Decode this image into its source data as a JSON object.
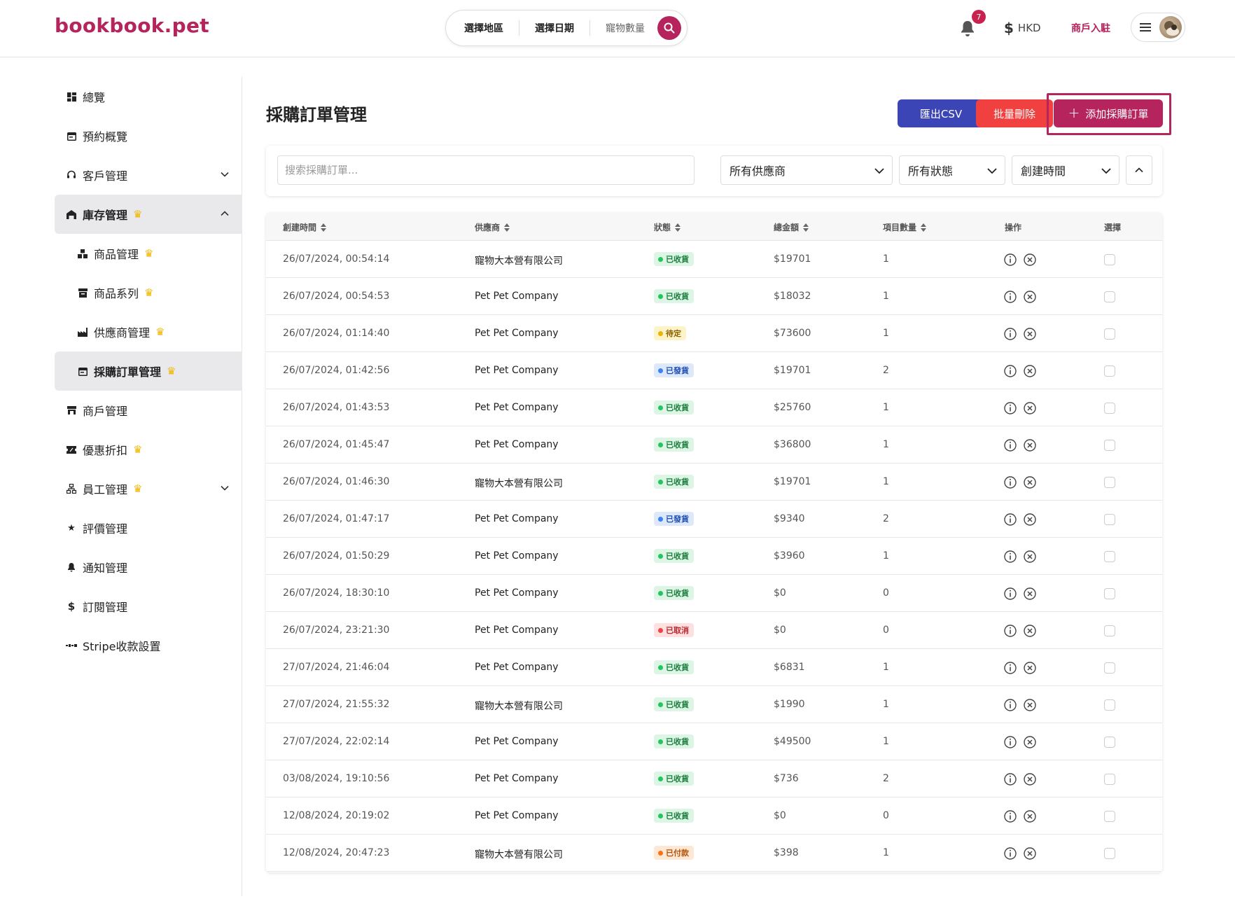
{
  "header": {
    "logo": "bookbook.pet",
    "search": {
      "region": "選擇地區",
      "date": "選擇日期",
      "pets": "寵物數量"
    },
    "notifications_count": "7",
    "currency": "HKD",
    "merchant_link": "商戶入駐"
  },
  "sidebar": {
    "items": [
      {
        "label": "總覽",
        "icon": "dashboard-icon"
      },
      {
        "label": "預約概覽",
        "icon": "calendar-icon"
      },
      {
        "label": "客戶管理",
        "icon": "headset-icon",
        "expandable": true
      },
      {
        "label": "庫存管理",
        "icon": "store-icon",
        "premium": true,
        "expanded": true
      },
      {
        "label": "商品管理",
        "icon": "boxes-icon",
        "premium": true,
        "sub": true
      },
      {
        "label": "商品系列",
        "icon": "archive-icon",
        "premium": true,
        "sub": true
      },
      {
        "label": "供應商管理",
        "icon": "factory-icon",
        "premium": true,
        "sub": true
      },
      {
        "label": "採購訂單管理",
        "icon": "calendar-icon",
        "premium": true,
        "sub": true,
        "active": true
      },
      {
        "label": "商戶管理",
        "icon": "shop-icon"
      },
      {
        "label": "優惠折扣",
        "icon": "ticket-icon",
        "premium": true
      },
      {
        "label": "員工管理",
        "icon": "org-icon",
        "premium": true,
        "expandable": true
      },
      {
        "label": "評價管理",
        "icon": "star-icon"
      },
      {
        "label": "通知管理",
        "icon": "bell-icon"
      },
      {
        "label": "訂閱管理",
        "icon": "dollar-icon"
      },
      {
        "label": "Stripe收款設置",
        "icon": "stripe-icon"
      }
    ]
  },
  "main": {
    "title": "採購訂單管理",
    "buttons": {
      "export": "匯出CSV",
      "bulk_delete": "批量刪除",
      "add": "添加採購訂單"
    },
    "filters": {
      "search_placeholder": "搜索採購訂單...",
      "supplier": "所有供應商",
      "status": "所有狀態",
      "sort": "創建時間"
    },
    "table": {
      "columns": [
        "創建時間",
        "供應商",
        "狀態",
        "總金額",
        "項目數量",
        "操作",
        "選擇"
      ],
      "rows": [
        {
          "created": "26/07/2024, 00:54:14",
          "supplier": "寵物大本營有限公司",
          "status": "已收貨",
          "status_type": "received",
          "total": "$19701",
          "qty": "1"
        },
        {
          "created": "26/07/2024, 00:54:53",
          "supplier": "Pet Pet Company",
          "status": "已收貨",
          "status_type": "received",
          "total": "$18032",
          "qty": "1"
        },
        {
          "created": "26/07/2024, 01:14:40",
          "supplier": "Pet Pet Company",
          "status": "待定",
          "status_type": "pending",
          "total": "$73600",
          "qty": "1"
        },
        {
          "created": "26/07/2024, 01:42:56",
          "supplier": "Pet Pet Company",
          "status": "已發貨",
          "status_type": "shipped",
          "total": "$19701",
          "qty": "2"
        },
        {
          "created": "26/07/2024, 01:43:53",
          "supplier": "Pet Pet Company",
          "status": "已收貨",
          "status_type": "received",
          "total": "$25760",
          "qty": "1"
        },
        {
          "created": "26/07/2024, 01:45:47",
          "supplier": "Pet Pet Company",
          "status": "已收貨",
          "status_type": "received",
          "total": "$36800",
          "qty": "1"
        },
        {
          "created": "26/07/2024, 01:46:30",
          "supplier": "寵物大本營有限公司",
          "status": "已收貨",
          "status_type": "received",
          "total": "$19701",
          "qty": "1"
        },
        {
          "created": "26/07/2024, 01:47:17",
          "supplier": "Pet Pet Company",
          "status": "已發貨",
          "status_type": "shipped",
          "total": "$9340",
          "qty": "2"
        },
        {
          "created": "26/07/2024, 01:50:29",
          "supplier": "Pet Pet Company",
          "status": "已收貨",
          "status_type": "received",
          "total": "$3960",
          "qty": "1"
        },
        {
          "created": "26/07/2024, 18:30:10",
          "supplier": "Pet Pet Company",
          "status": "已收貨",
          "status_type": "received",
          "total": "$0",
          "qty": "0"
        },
        {
          "created": "26/07/2024, 23:21:30",
          "supplier": "Pet Pet Company",
          "status": "已取消",
          "status_type": "cancelled",
          "total": "$0",
          "qty": "0"
        },
        {
          "created": "27/07/2024, 21:46:04",
          "supplier": "Pet Pet Company",
          "status": "已收貨",
          "status_type": "received",
          "total": "$6831",
          "qty": "1"
        },
        {
          "created": "27/07/2024, 21:55:32",
          "supplier": "寵物大本營有限公司",
          "status": "已收貨",
          "status_type": "received",
          "total": "$1990",
          "qty": "1"
        },
        {
          "created": "27/07/2024, 22:02:14",
          "supplier": "Pet Pet Company",
          "status": "已收貨",
          "status_type": "received",
          "total": "$49500",
          "qty": "1"
        },
        {
          "created": "03/08/2024, 19:10:56",
          "supplier": "Pet Pet Company",
          "status": "已收貨",
          "status_type": "received",
          "total": "$736",
          "qty": "2"
        },
        {
          "created": "12/08/2024, 20:19:02",
          "supplier": "Pet Pet Company",
          "status": "已收貨",
          "status_type": "received",
          "total": "$0",
          "qty": "0"
        },
        {
          "created": "12/08/2024, 20:47:23",
          "supplier": "寵物大本營有限公司",
          "status": "已付款",
          "status_type": "paid",
          "total": "$398",
          "qty": "1"
        }
      ]
    }
  },
  "colors": {
    "brand": "#b5245c",
    "export": "#3b45b5",
    "delete": "#f0403f",
    "premium": "#f2b600",
    "status_received_bg": "#dcf5e4",
    "status_received_fg": "#1a7f3e",
    "status_received_dot": "#22c55e",
    "status_pending_bg": "#fdf3c8",
    "status_pending_fg": "#8a6100",
    "status_pending_dot": "#eab308",
    "status_shipped_bg": "#dde8fb",
    "status_shipped_fg": "#1e4fb3",
    "status_shipped_dot": "#3b82f6",
    "status_cancelled_bg": "#fde0e0",
    "status_cancelled_fg": "#c0262d",
    "status_cancelled_dot": "#ef4444",
    "status_paid_bg": "#fde8d6",
    "status_paid_fg": "#b45309",
    "status_paid_dot": "#f97316"
  }
}
